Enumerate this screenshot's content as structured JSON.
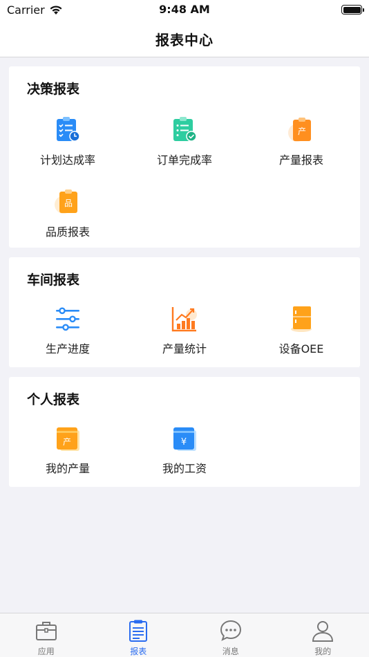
{
  "status": {
    "carrier": "Carrier",
    "time": "9:48 AM"
  },
  "header": {
    "title": "报表中心"
  },
  "sections": [
    {
      "title": "决策报表",
      "items": [
        {
          "label": "计划达成率",
          "icon": "clipboard-checklist-clock-icon",
          "color": "#2a8cf7"
        },
        {
          "label": "订单完成率",
          "icon": "clipboard-checklist-check-icon",
          "color": "#2ecda0"
        },
        {
          "label": "产量报表",
          "icon": "clipboard-chan-icon",
          "color": "#ff8f1f"
        },
        {
          "label": "品质报表",
          "icon": "clipboard-pin-icon",
          "color": "#ffa21a"
        }
      ]
    },
    {
      "title": "车间报表",
      "items": [
        {
          "label": "生产进度",
          "icon": "sliders-icon",
          "color": "#2a8cf7"
        },
        {
          "label": "产量统计",
          "icon": "bar-chart-trend-icon",
          "color": "#ff7a1f"
        },
        {
          "label": "设备OEE",
          "icon": "cabinet-icon",
          "color": "#ffa21a"
        }
      ]
    },
    {
      "title": "个人报表",
      "items": [
        {
          "label": "我的产量",
          "icon": "card-chan-icon",
          "color": "#ffa21a"
        },
        {
          "label": "我的工资",
          "icon": "card-yen-icon",
          "color": "#2a8cf7"
        }
      ]
    }
  ],
  "icon_glyphs": {
    "chan": "产",
    "pin": "品",
    "yen": "¥"
  },
  "tabs": [
    {
      "label": "应用",
      "icon": "briefcase-icon",
      "active": false
    },
    {
      "label": "报表",
      "icon": "report-clipboard-icon",
      "active": true
    },
    {
      "label": "消息",
      "icon": "chat-bubble-icon",
      "active": false
    },
    {
      "label": "我的",
      "icon": "person-icon",
      "active": false
    }
  ],
  "colors": {
    "accent": "#2a6cf0",
    "background": "#f2f2f7",
    "inactive": "#777777"
  }
}
